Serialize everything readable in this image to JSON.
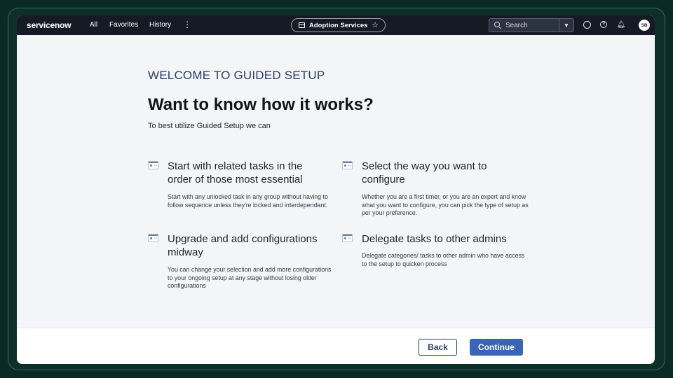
{
  "topbar": {
    "logo": "servicenow",
    "nav": [
      "All",
      "Favorites",
      "History"
    ],
    "more_label": "⋮",
    "app_name": "Adoption Services",
    "search_placeholder": "Search",
    "user_initials": "SB"
  },
  "content": {
    "eyebrow": "WELCOME TO GUIDED SETUP",
    "headline": "Want to know how it works?",
    "subline": "To best utilize Guided Setup we can",
    "features": [
      {
        "title": "Start with related tasks in the order of those most essential",
        "description": "Start with any unlocked task in any group without having to follow sequence unless they're locked and interdependant."
      },
      {
        "title": "Select the way you want to configure",
        "description": "Whether you are a first timer, or you are an expert and know what you want to configure, you can pick the type of setup as per your preference."
      },
      {
        "title": "Upgrade and add configurations midway",
        "description": "You can change your selection and add more configurations to your ongoing setup at any stage without losing older configurations"
      },
      {
        "title": "Delegate tasks to other admins",
        "description": "Delegate categories/ tasks to other admin who have access to the setup to quicken process"
      }
    ]
  },
  "footer": {
    "back_label": "Back",
    "continue_label": "Continue"
  },
  "colors": {
    "topbar": "#151b24",
    "accent": "#3a64b5",
    "eyebrow": "#2c3d66"
  }
}
